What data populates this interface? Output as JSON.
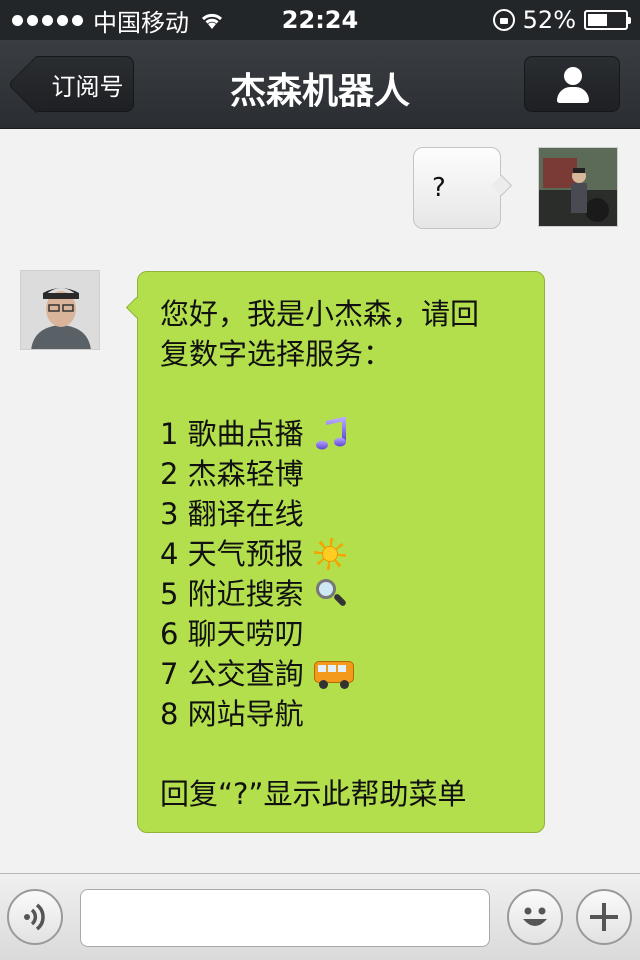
{
  "status_bar": {
    "carrier": "中国移动",
    "time": "22:24",
    "battery_text": "52%",
    "battery_level_percent": 52,
    "signal_bars": 5
  },
  "nav": {
    "back_label": "订阅号",
    "title": "杰森机器人",
    "profile_icon": "person-icon"
  },
  "messages": {
    "user": {
      "text": "?"
    },
    "bot": {
      "intro_line1": "您好，我是小杰森，请回",
      "intro_line2": "复数字选择服务：",
      "menu": [
        {
          "text": "1 歌曲点播",
          "icon": "music-note-icon"
        },
        {
          "text": "2 杰森轻博",
          "icon": ""
        },
        {
          "text": "3 翻译在线",
          "icon": ""
        },
        {
          "text": "4 天气预报",
          "icon": "sun-icon"
        },
        {
          "text": "5 附近搜索",
          "icon": "magnifier-icon"
        },
        {
          "text": "6 聊天唠叨",
          "icon": ""
        },
        {
          "text": "7 公交查詢",
          "icon": "bus-icon"
        },
        {
          "text": "8 网站导航",
          "icon": ""
        }
      ],
      "footer": "回复“?”显示此帮助菜单"
    }
  },
  "input_bar": {
    "input_value": "",
    "voice_icon": "voice-icon",
    "emoji_icon": "smiley-icon",
    "plus_icon": "plus-icon"
  },
  "colors": {
    "nav_bg": "#2f3236",
    "chat_bg": "#f2f2f2",
    "bot_bubble": "#b3df4c",
    "user_bubble": "#f2f2f2"
  }
}
